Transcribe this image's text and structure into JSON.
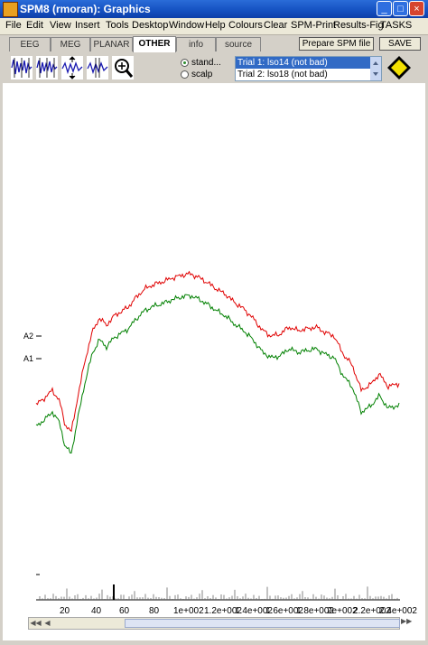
{
  "window": {
    "title": "SPM8 (rmoran): Graphics",
    "minimize": "_",
    "maximize": "□",
    "close": "×"
  },
  "menu": [
    "File",
    "Edit",
    "View",
    "Insert",
    "Tools",
    "Desktop",
    "Window",
    "Help",
    "Colours",
    "Clear",
    "SPM-Print",
    "Results-Fig",
    "TASKS"
  ],
  "tabs": [
    "EEG",
    "MEG",
    "PLANAR",
    "OTHER",
    "info",
    "source"
  ],
  "active_tab": "OTHER",
  "buttons": {
    "prepare": "Prepare SPM file",
    "save": "SAVE"
  },
  "radios": [
    {
      "label": "stand...",
      "checked": true
    },
    {
      "label": "scalp",
      "checked": false
    }
  ],
  "trials": [
    {
      "label": "Trial 1: lso14 (not bad)",
      "selected": true
    },
    {
      "label": "Trial 2: lso18 (not bad)",
      "selected": false
    }
  ],
  "channel_labels": [
    "A2",
    "A1"
  ],
  "x_ticks": [
    "20",
    "40",
    "60",
    "80",
    "1e+002",
    "1.2e+002",
    "1.4e+002",
    "1.6e+002",
    "1.8e+002",
    "2e+002",
    "2.2e+002",
    "2.4e+002"
  ],
  "colors": {
    "trial1": "#e00000",
    "trial2": "#008000",
    "selection": "#316ac5"
  }
}
